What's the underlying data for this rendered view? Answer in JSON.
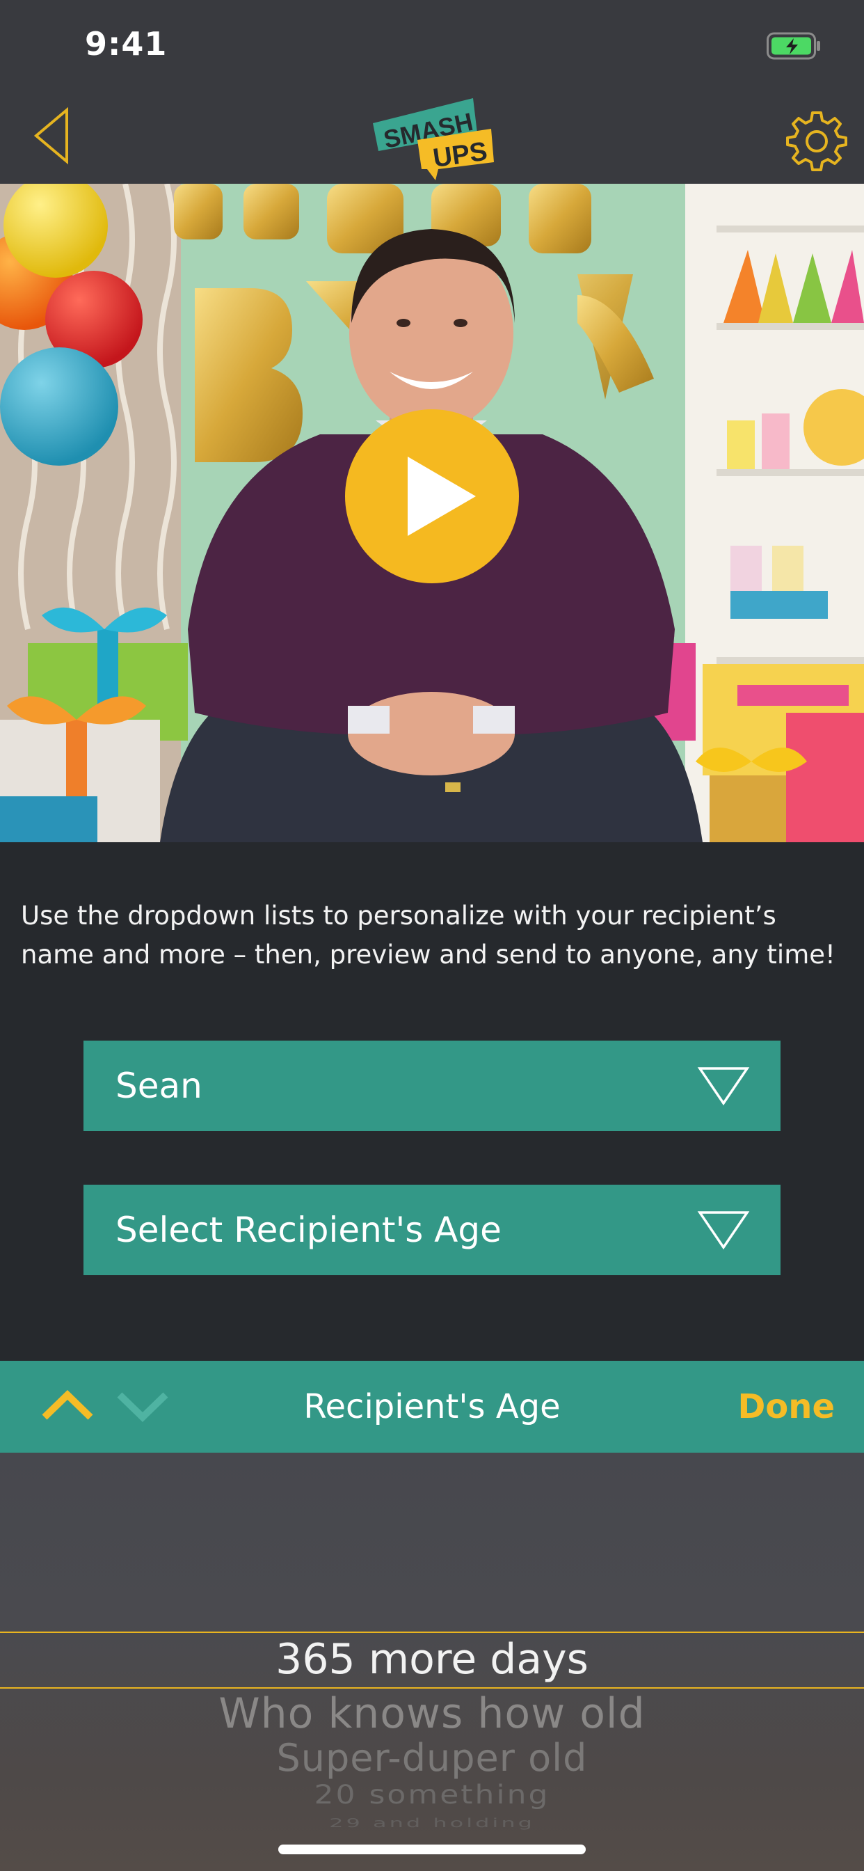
{
  "status_bar": {
    "time": "9:41"
  },
  "header": {
    "logo_line1": "SMASH",
    "logo_line2": "UPS"
  },
  "video": {
    "play_icon": "play-icon"
  },
  "instructions": "Use the dropdown lists to personalize with your recipient’s name and more – then, preview and send to anyone, any time!",
  "dropdowns": {
    "name": {
      "value": "Sean"
    },
    "age": {
      "placeholder": "Select Recipient's Age"
    }
  },
  "picker_toolbar": {
    "title": "Recipient's Age",
    "done_label": "Done"
  },
  "picker": {
    "selected": "365 more days",
    "options_below": [
      "Who knows how old",
      "Super-duper old",
      "20 something",
      "29 and holding"
    ]
  },
  "colors": {
    "accent_yellow": "#f5bc26",
    "teal": "#339887",
    "background": "#26292d",
    "bar": "#393a3f"
  }
}
